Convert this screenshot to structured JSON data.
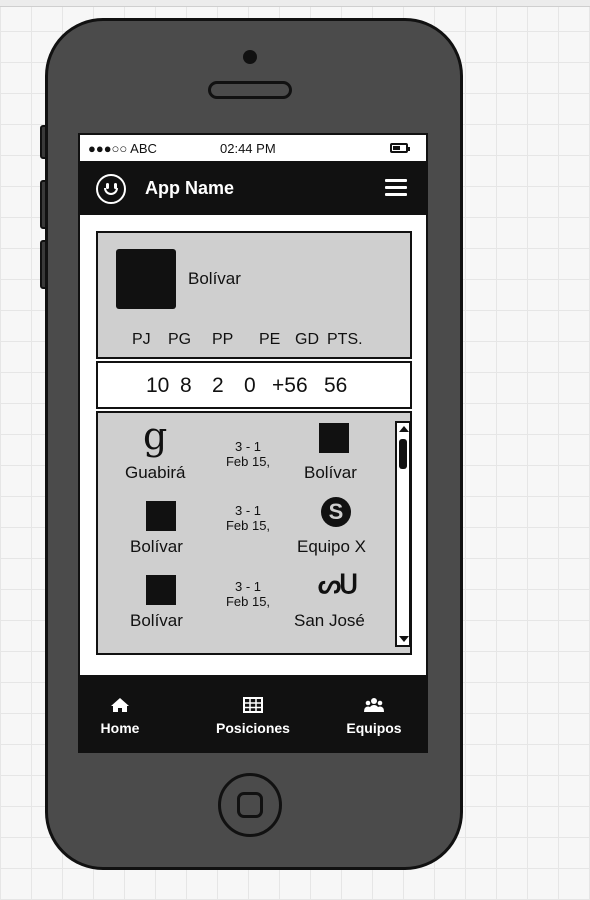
{
  "status_bar": {
    "carrier": "●●●○○ ABC",
    "time": "02:44 PM",
    "battery": 0.6
  },
  "header": {
    "app_name": "App Name",
    "logo_icon": "smiley-icon",
    "menu_icon": "hamburger-menu-icon"
  },
  "team": {
    "name": "Bolívar"
  },
  "stats": {
    "headers": [
      "PJ",
      "PG",
      "PP",
      "PE",
      "GD",
      "PTS."
    ],
    "values": [
      "10",
      "8",
      "2",
      "0",
      "+56",
      "56"
    ]
  },
  "matches": [
    {
      "home": "Guabirá",
      "home_icon": "google-icon",
      "score": "3 - 1",
      "date": "Feb 15,",
      "away": "Bolívar",
      "away_icon": "square-logo"
    },
    {
      "home": "Bolívar",
      "home_icon": "square-logo",
      "score": "3 - 1",
      "date": "Feb 15,",
      "away": "Equipo X",
      "away_icon": "skype-icon"
    },
    {
      "home": "Bolívar",
      "home_icon": "square-logo",
      "score": "3 - 1",
      "date": "Feb 15,",
      "away": "San José",
      "away_icon": "stumbleupon-icon"
    }
  ],
  "tab_bar": [
    {
      "label": "Home",
      "icon": "home-icon"
    },
    {
      "label": "Posiciones",
      "icon": "table-icon"
    },
    {
      "label": "Equipos",
      "icon": "users-icon"
    }
  ]
}
